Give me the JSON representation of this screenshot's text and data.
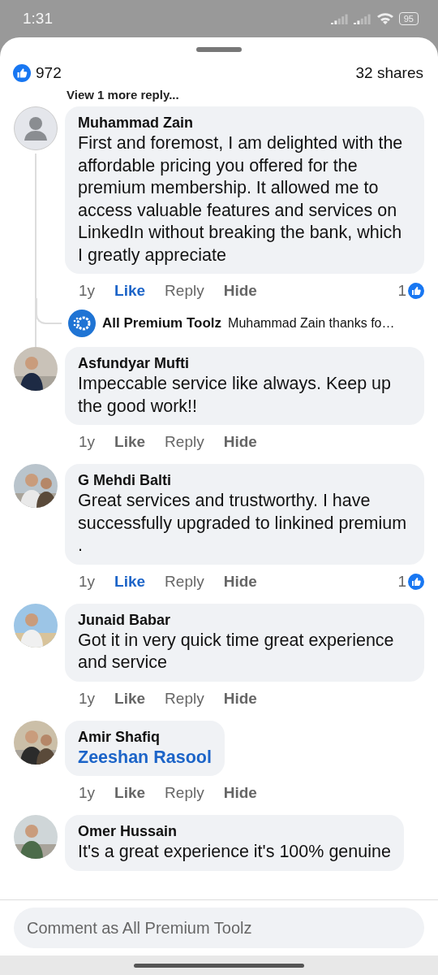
{
  "status_bar": {
    "time": "1:31",
    "battery": "95"
  },
  "header": {
    "reactions": "972",
    "shares": "32 shares"
  },
  "view_more": "View 1 more reply...",
  "comments": [
    {
      "name": "Muhammad Zain",
      "avatar": {
        "kind": "default"
      },
      "text": "First and foremost, I am delighted with the affordable pricing you offered for the premium membership. It allowed me to access valuable features and services on LinkedIn without breaking the bank, which I greatly appreciate",
      "time": "1y",
      "like": "Like",
      "liked": true,
      "reply": "Reply",
      "hide": "Hide",
      "reactions": "1",
      "replies": [
        {
          "name": "All Premium Toolz",
          "text": "Muhammad Zain thanks fo…"
        }
      ]
    },
    {
      "name": "Asfundyar Mufti",
      "text": "Impeccable service like always. Keep up the good work!!",
      "time": "1y",
      "like": "Like",
      "liked": false,
      "reply": "Reply",
      "hide": "Hide"
    },
    {
      "name": "G Mehdi Balti",
      "text": "Great services and trustworthy.  I have successfully  upgraded to linkined premium .",
      "time": "1y",
      "like": "Like",
      "liked": true,
      "reply": "Reply",
      "hide": "Hide",
      "reactions": "1"
    },
    {
      "name": "Junaid Babar",
      "text": "Got it in very quick time great experience and service",
      "time": "1y",
      "like": "Like",
      "liked": false,
      "reply": "Reply",
      "hide": "Hide"
    },
    {
      "name": "Amir Shafiq",
      "mention": "Zeeshan Rasool",
      "time": "1y",
      "like": "Like",
      "liked": false,
      "reply": "Reply",
      "hide": "Hide"
    },
    {
      "name": "Omer Hussain",
      "text": "It's a great experience it's 100% genuine"
    }
  ],
  "composer": {
    "placeholder": "Comment as All Premium Toolz"
  }
}
